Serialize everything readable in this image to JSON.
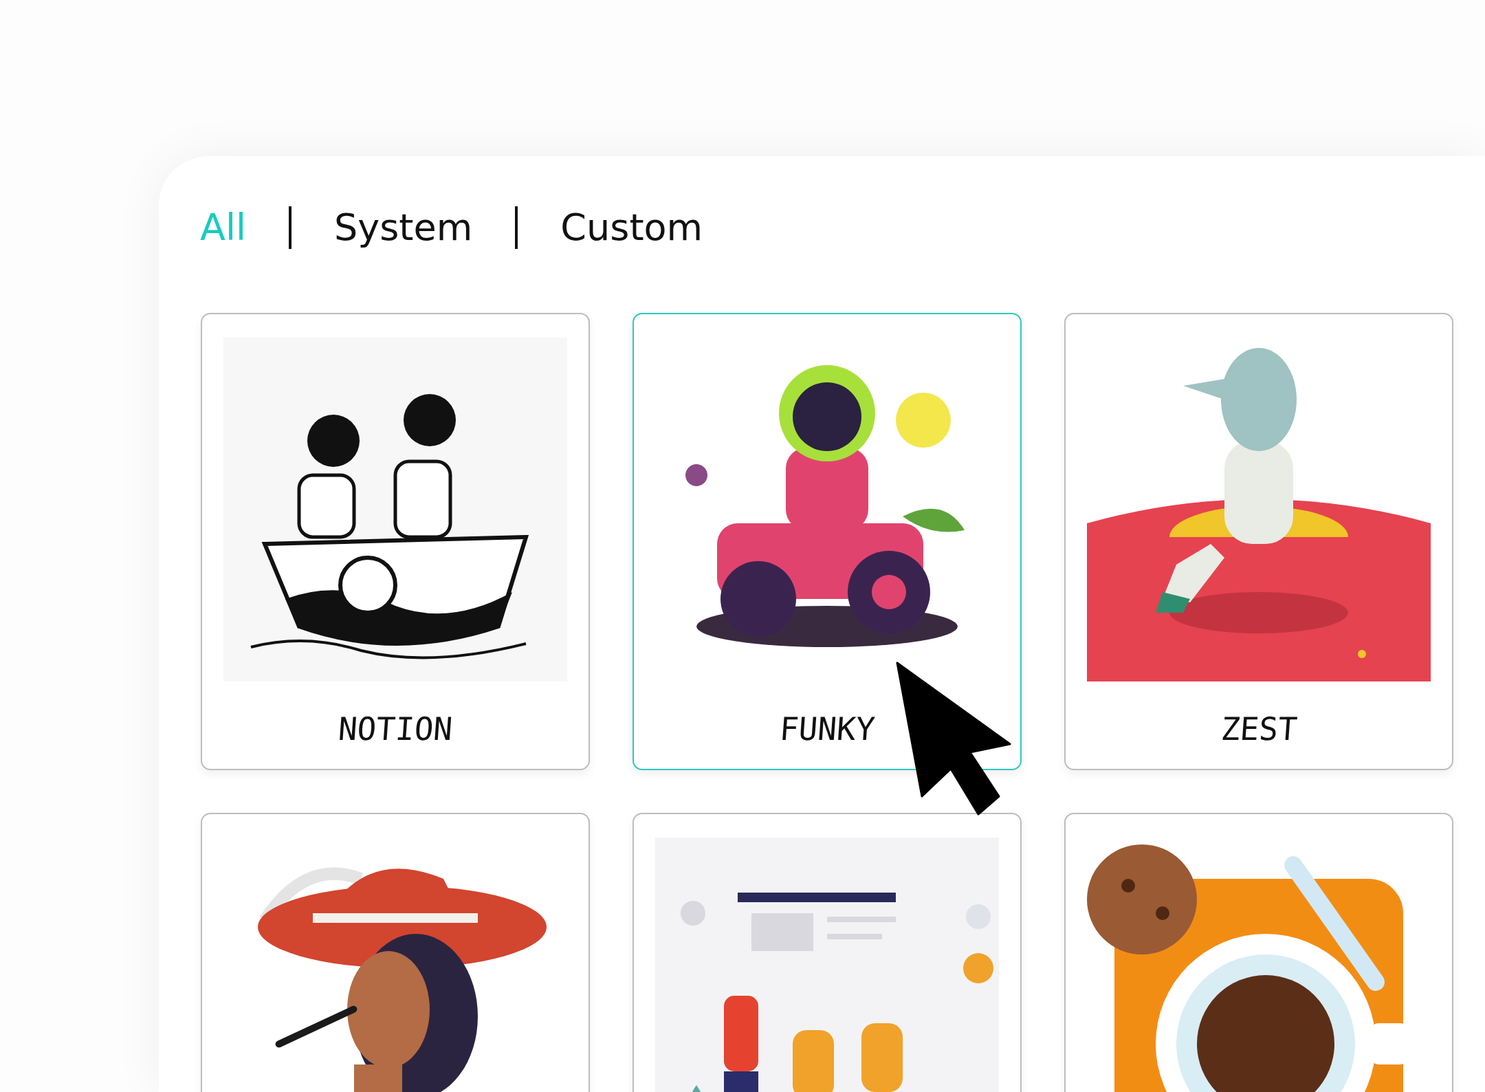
{
  "tabs": [
    {
      "label": "All",
      "selected": true
    },
    {
      "label": "System",
      "selected": false
    },
    {
      "label": "Custom",
      "selected": false
    }
  ],
  "cards": [
    {
      "label": "NOTION",
      "selected": false
    },
    {
      "label": "FUNKY",
      "selected": true
    },
    {
      "label": "ZEST",
      "selected": false
    },
    {
      "selected": false
    },
    {
      "selected": false
    },
    {
      "selected": false
    }
  ]
}
